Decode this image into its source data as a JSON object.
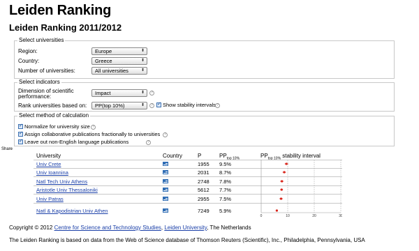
{
  "title": "Leiden Ranking",
  "subtitle": "Leiden Ranking 2011/2012",
  "select_universities": {
    "legend": "Select universities",
    "region_label": "Region:",
    "region_value": "Europe",
    "country_label": "Country:",
    "country_value": "Greece",
    "number_label": "Number of universities:",
    "number_value": "All universities"
  },
  "select_indicators": {
    "legend": "Select indicators",
    "dimension_label_1": "Dimension of scientific",
    "dimension_label_2": "performance:",
    "dimension_value": "Impact",
    "rank_label": "Rank universities based on:",
    "rank_value": "PP(top 10%)",
    "stability_label": "Show stability intervals",
    "stability_checked": true
  },
  "select_method": {
    "legend": "Select method of calculation",
    "normalize_label": "Normalize for university size",
    "normalize_checked": true,
    "collab_label": "Assign collaborative publications fractionally to universities",
    "collab_checked": true,
    "english_label": "Leave out non-English language publications",
    "english_checked": true
  },
  "share_label": "Share",
  "table": {
    "headers": {
      "university": "University",
      "country": "Country",
      "p": "P",
      "pp_main": "PP",
      "pp_sub": "top 10%",
      "interval_main": "PP",
      "interval_sub": "top 10%",
      "interval_rest": " stability interval"
    },
    "rows": [
      {
        "university": "Univ Crete",
        "p": "1955",
        "pp": "9.5%"
      },
      {
        "university": "Univ Ioannina",
        "p": "2031",
        "pp": "8.7%"
      },
      {
        "university": "Natl Tech Univ Athens",
        "p": "2748",
        "pp": "7.8%"
      },
      {
        "university": "Aristotle Univ Thessaloniki",
        "p": "5612",
        "pp": "7.7%"
      },
      {
        "university": "Univ Patras",
        "p": "2955",
        "pp": "7.5%"
      },
      {
        "university": "Natl & Kapodistrian Univ Athen",
        "p": "7249",
        "pp": "5.9%"
      }
    ],
    "axis_ticks": [
      "0",
      "10",
      "20",
      "30"
    ],
    "axis_max": 30,
    "intervals": [
      {
        "value": 9.5,
        "low": 8.9,
        "high": 10.2
      },
      {
        "value": 8.7,
        "low": 8.1,
        "high": 9.3
      },
      {
        "value": 7.8,
        "low": 7.2,
        "high": 8.4
      },
      {
        "value": 7.7,
        "low": 7.2,
        "high": 8.2
      },
      {
        "value": 7.5,
        "low": 6.9,
        "high": 8.1
      },
      {
        "value": 5.9,
        "low": 5.5,
        "high": 6.3
      }
    ],
    "marker_color": "#d9261c"
  },
  "footer": {
    "copyright_prefix": "Copyright © 2012 ",
    "cwts_link": "Centre for Science and Technology Studies",
    "sep": ", ",
    "leiden_link": "Leiden University",
    "suffix": ", The Netherlands",
    "data_note": "The Leiden Ranking is based on data from the Web of Science database of Thomson Reuters (Scientific), Inc., Philadelphia, Pennsylvania, USA"
  }
}
